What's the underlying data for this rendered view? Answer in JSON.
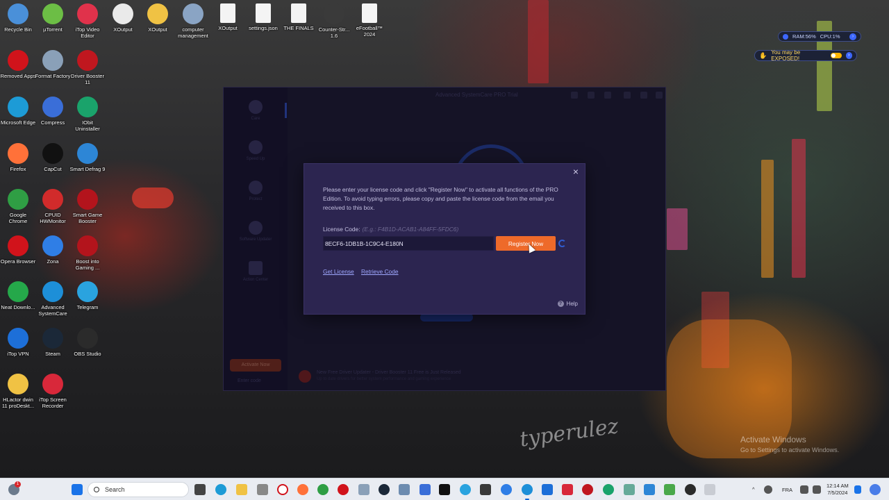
{
  "desktop": {
    "icons": [
      {
        "label": "Recycle Bin",
        "icon": "recycle-bin-icon",
        "color": "#4a90d9"
      },
      {
        "label": "µTorrent",
        "icon": "utorrent-icon",
        "color": "#6cbe45"
      },
      {
        "label": "iTop Video Editor",
        "icon": "video-editor-icon",
        "color": "#e0324b"
      },
      {
        "label": "XOutput",
        "icon": "xoutput-icon",
        "color": "#eaeaea"
      },
      {
        "label": "XOutput",
        "icon": "folder-icon",
        "color": "#f0c244"
      },
      {
        "label": "computer management",
        "icon": "computer-management-icon",
        "color": "#8aa4c4"
      },
      {
        "label": "XOutput",
        "icon": "file-icon",
        "color": "#f4f4f4"
      },
      {
        "label": "settings.json",
        "icon": "file-icon",
        "color": "#f4f4f4"
      },
      {
        "label": "THE FINALS",
        "icon": "file-icon",
        "color": "#f4f4f4"
      },
      {
        "label": "Counter-Str... 1.6",
        "icon": "counter-strike-icon",
        "color": "#3a3a3a"
      },
      {
        "label": "eFootball™ 2024",
        "icon": "file-icon",
        "color": "#f4f4f4"
      },
      {
        "label": "Removed Apps",
        "icon": "opera-icon",
        "color": "#d1131b"
      },
      {
        "label": "Format Factory",
        "icon": "format-factory-icon",
        "color": "#8aa0b8"
      },
      {
        "label": "Driver Booster 11",
        "icon": "driver-booster-icon",
        "color": "#c0171f"
      },
      {
        "label": "Microsoft Edge",
        "icon": "edge-icon",
        "color": "#1d9bd6"
      },
      {
        "label": "Compress",
        "icon": "compress-icon",
        "color": "#3a6ed8"
      },
      {
        "label": "IObit Uninstaller",
        "icon": "iobit-uninstaller-icon",
        "color": "#1aa36b"
      },
      {
        "label": "Firefox",
        "icon": "firefox-icon",
        "color": "#ff7139"
      },
      {
        "label": "CapCut",
        "icon": "capcut-icon",
        "color": "#111111"
      },
      {
        "label": "Smart Defrag 9",
        "icon": "smart-defrag-icon",
        "color": "#2d86d6"
      },
      {
        "label": "Google Chrome",
        "icon": "chrome-icon",
        "color": "#2f9e44"
      },
      {
        "label": "CPUID HWMonitor",
        "icon": "hwmonitor-icon",
        "color": "#d12b2b"
      },
      {
        "label": "Smart Game Booster",
        "icon": "game-booster-icon",
        "color": "#b3141c"
      },
      {
        "label": "Opera Browser",
        "icon": "opera-icon",
        "color": "#d1131b"
      },
      {
        "label": "Zona",
        "icon": "zona-icon",
        "color": "#2f7ee6"
      },
      {
        "label": "Boost into Gaming ...",
        "icon": "game-booster-icon",
        "color": "#b3141c"
      },
      {
        "label": "Neat Downlo...",
        "icon": "neat-download-icon",
        "color": "#25a84a"
      },
      {
        "label": "Advanced SystemCare",
        "icon": "advanced-systemcare-icon",
        "color": "#1d8fd8"
      },
      {
        "label": "Telegram",
        "icon": "telegram-icon",
        "color": "#2aa3df"
      },
      {
        "label": "iTop VPN",
        "icon": "vpn-icon",
        "color": "#1d6fd8"
      },
      {
        "label": "Steam",
        "icon": "steam-icon",
        "color": "#1b2838"
      },
      {
        "label": "OBS Studio",
        "icon": "obs-icon",
        "color": "#2b2b2b"
      },
      {
        "label": "HLactor dwin 11 proDeskt...",
        "icon": "folder-icon",
        "color": "#f0c244"
      },
      {
        "label": "iTop Screen Recorder",
        "icon": "screen-recorder-icon",
        "color": "#d8283a"
      }
    ]
  },
  "widgets": {
    "ram_text": "RAM:56%",
    "cpu_text": "CPU:1%",
    "exposed_text": "You may be EXPOSED!"
  },
  "app": {
    "title": "Advanced SystemCare PRO Trial",
    "sidebar": [
      "Care",
      "Speed Up",
      "Protect",
      "Software Updater",
      "Action Center"
    ],
    "activate_button": "Activate Now",
    "enter_code": "Enter code",
    "news_line1": "New Free Driver Updater - Driver Booster 11 Free is Just Released",
    "news_line2": "Up to date drivers for better system performance and gaming experience"
  },
  "dialog": {
    "description": "Please enter your license code and click \"Register Now\" to activate all functions of the PRO Edition. To avoid typing errors, please copy and paste the license code from the email you received to this box.",
    "license_label": "License Code:",
    "license_example": "(E.g.: F4B1D-ACAB1-A84FF-5FDC6)",
    "license_value": "8ECF6-1DB1B-1C9C4-E180N",
    "register_button": "Register Now",
    "get_license": "Get License",
    "retrieve_code": "Retrieve Code",
    "help": "Help",
    "close_symbol": "×"
  },
  "watermark": {
    "signature": "typerulez",
    "activate_line1": "Activate Windows",
    "activate_line2": "Go to Settings to activate Windows."
  },
  "taskbar": {
    "search_placeholder": "Search",
    "language": "FRA",
    "time": "12:14 AM",
    "date": "7/5/2024",
    "notification_count": "1"
  }
}
